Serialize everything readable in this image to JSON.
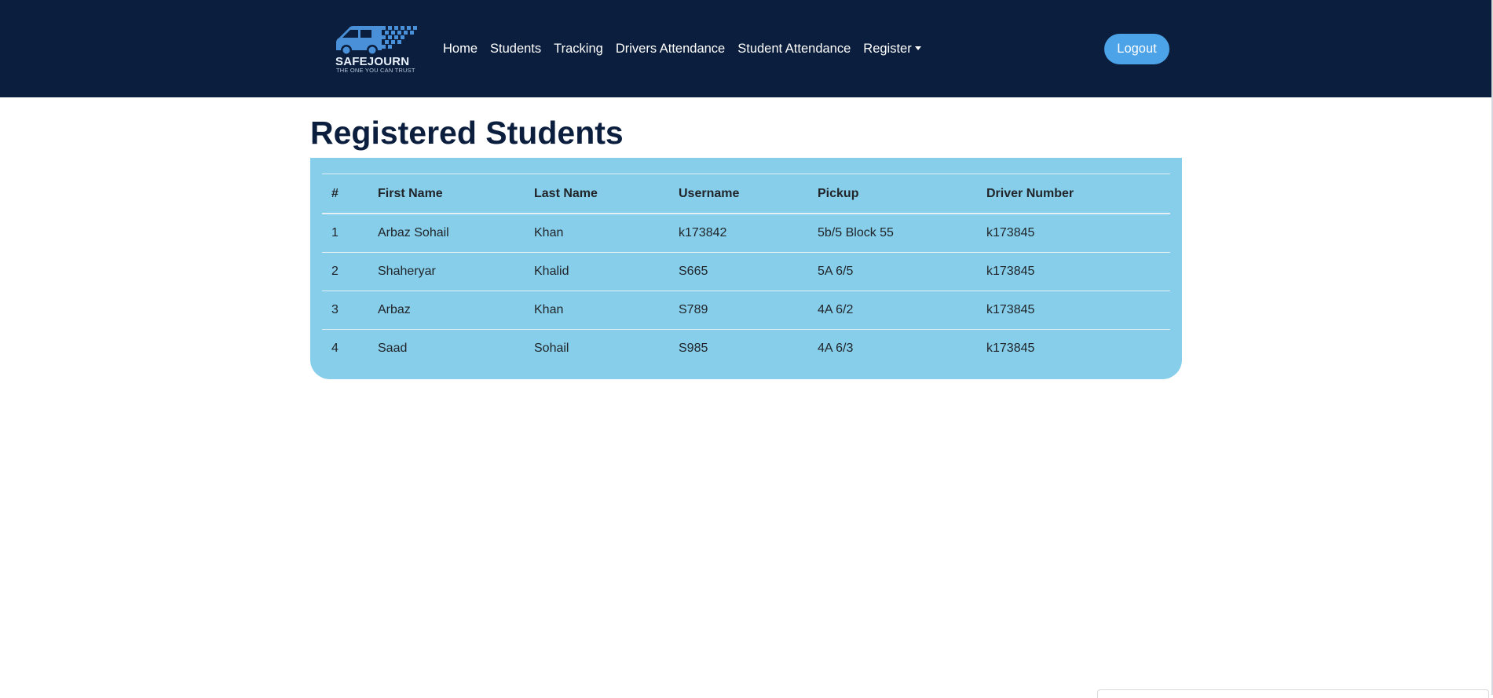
{
  "brand": {
    "name": "SAFEJOURN",
    "tagline": "THE ONE YOU CAN TRUST"
  },
  "nav": {
    "links": [
      {
        "label": "Home"
      },
      {
        "label": "Students"
      },
      {
        "label": "Tracking"
      },
      {
        "label": "Drivers Attendance"
      },
      {
        "label": "Student Attendance"
      },
      {
        "label": "Register"
      }
    ],
    "logout_label": "Logout"
  },
  "page": {
    "title": "Registered Students"
  },
  "table": {
    "headers": [
      "#",
      "First Name",
      "Last Name",
      "Username",
      "Pickup",
      "Driver Number"
    ],
    "rows": [
      [
        "1",
        "Arbaz Sohail",
        "Khan",
        "k173842",
        "5b/5 Block 55",
        "k173845"
      ],
      [
        "2",
        "Shaheryar",
        "Khalid",
        "S665",
        "5A 6/5",
        "k173845"
      ],
      [
        "3",
        "Arbaz",
        "Khan",
        "S789",
        "4A 6/2",
        "k173845"
      ],
      [
        "4",
        "Saad",
        "Sohail",
        "S985",
        "4A 6/3",
        "k173845"
      ]
    ]
  },
  "colors": {
    "navbar_bg": "#0b1e3d",
    "accent": "#4da3e8",
    "table_bg": "#87ceeb",
    "title": "#0b1e3d"
  }
}
